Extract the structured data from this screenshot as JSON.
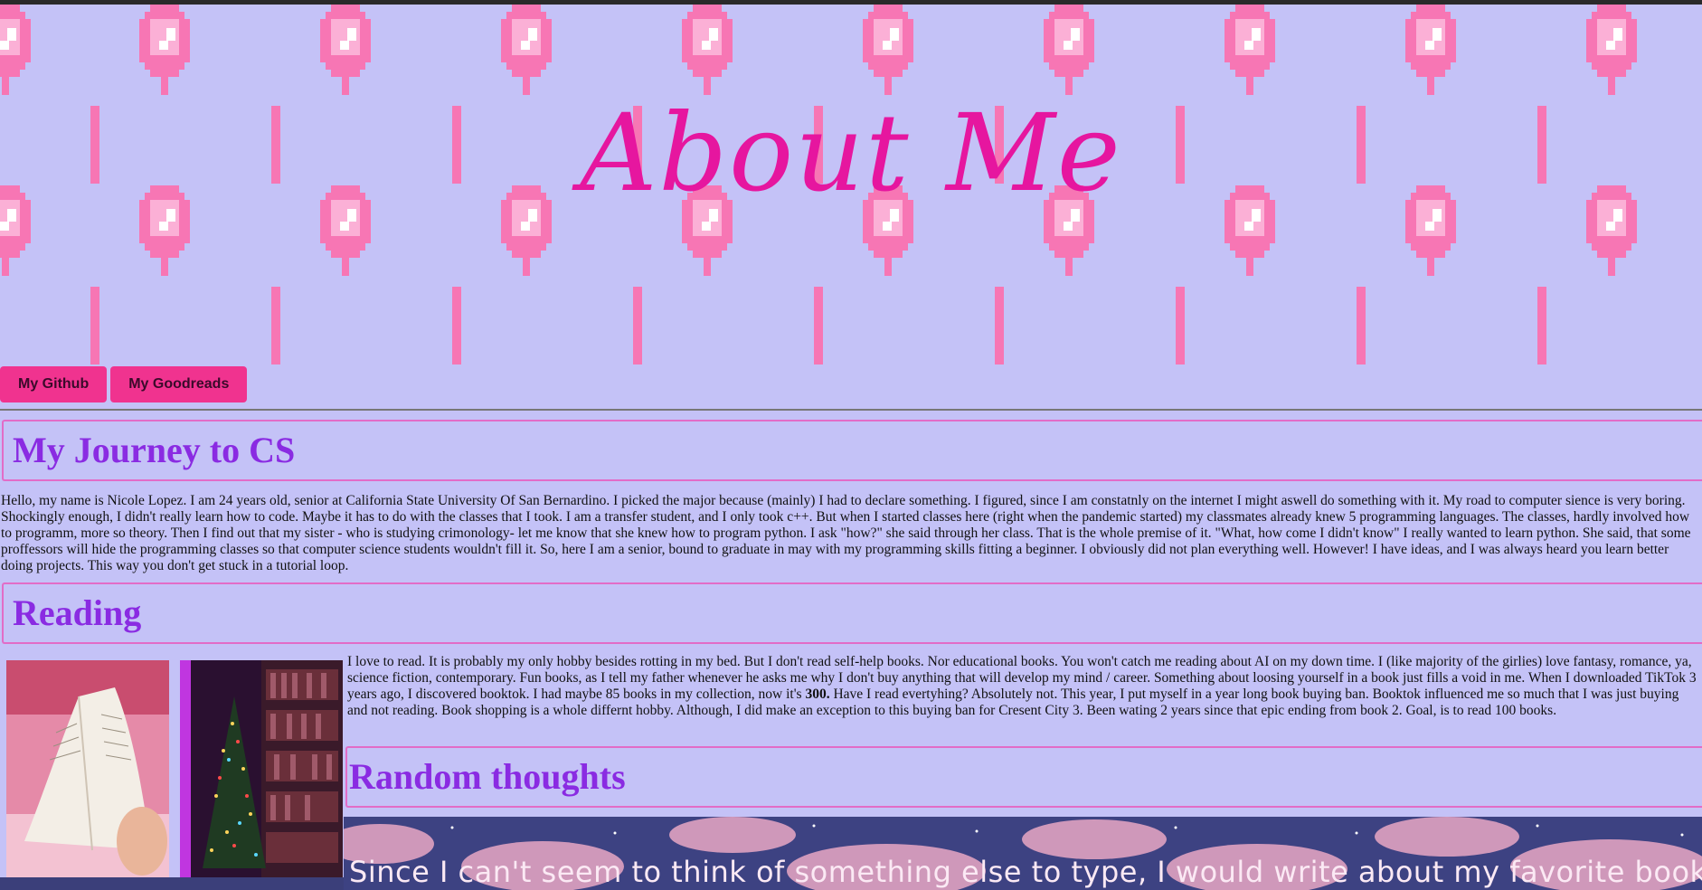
{
  "header": {
    "title": "About Me"
  },
  "nav": {
    "github_label": "My Github",
    "goodreads_label": "My Goodreads"
  },
  "journey": {
    "heading": "My Journey to CS",
    "text": "Hello, my name is Nicole Lopez. I am 24 years old, senior at California State University Of San Bernardino. I picked the major because (mainly) I had to declare something. I figured, since I am constatnly on the internet I might aswell do something with it. My road to computer sience is very boring. Shockingly enough, I didn't really learn how to code. Maybe it has to do with the classes that I took. I am a transfer student, and I only took c++. But when I started classes here (right when the pandemic started) my classmates already knew 5 programming languages. The classes, hardly involved how to programm, more so theory. Then I find out that my sister - who is studying crimonology- let me know that she knew how to program python. I ask \"how?\" she said through her class. That is the whole premise of it. \"What, how come I didn't know\" I really wanted to learn python. She said, that some proffessors will hide the programming classes so that computer science students wouldn't fill it. So, here I am a senior, bound to graduate in may with my programming skills fitting a beginner. I obviously did not plan everything well. However! I have ideas, and I was always heard you learn better doing projects. This way you don't get stuck in a tutorial loop."
  },
  "reading": {
    "heading": "Reading",
    "text_before": "I love to read. It is probably my only hobby besides rotting in my bed. But I don't read self-help books. Nor educational books. You won't catch me reading about AI on my down time. I (like majority of the girlies) love fantasy, romance, ya, science fiction, contemporary. Fun books, as I tell my father whenever he asks me why I don't buy anything that will develop my mind / career. Something about loosing yourself in a book just fills a void in me. When I downloaded TikTok 3 years ago, I discovered booktok. I had maybe 85 books in my collection, now it's ",
    "bold_number": "300.",
    "text_after": " Have I read evertyhing? Absolutely not. This year, I put myself in a year long book buying ban. Booktok influenced me so much that I was just buying and not reading. Book shopping is a whole differnt hobby. Although, I did make an exception to this buying ban for Cresent City 3. Been wating 2 years since that epic ending from book 2. Goal, is to read 100 books."
  },
  "random": {
    "heading": "Random thoughts",
    "text": "Since I can't seem to think of something else to type, I would write about my favorite books.  This might be"
  },
  "colors": {
    "background": "#c4c2f7",
    "accent_pink": "#f0338f",
    "title_pink": "#e6169f",
    "heading_purple": "#8a2be2",
    "section_border": "#e26cc7"
  }
}
